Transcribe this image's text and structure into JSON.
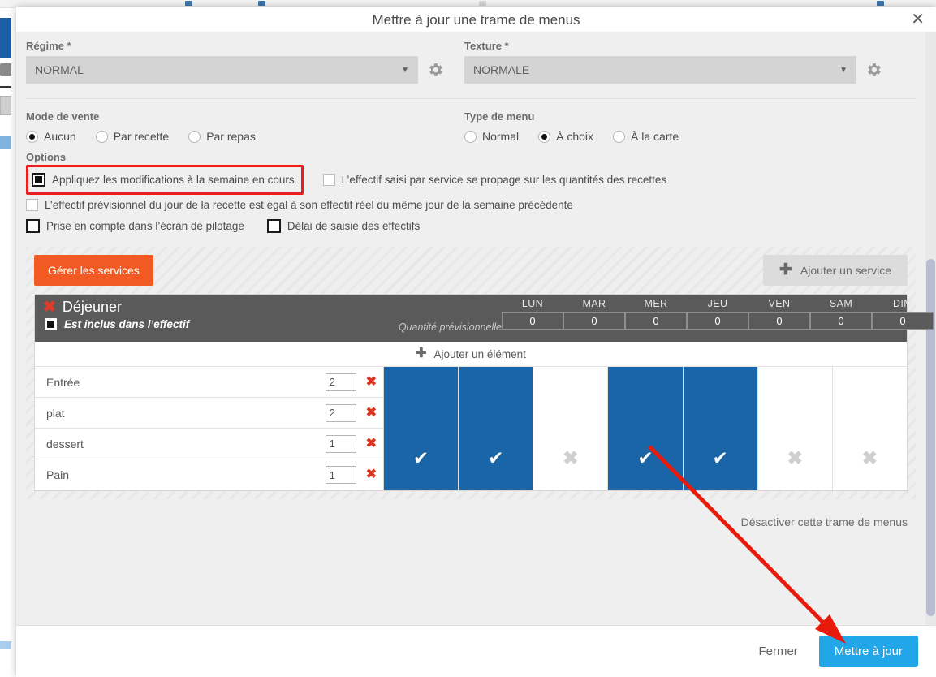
{
  "modal": {
    "title": "Mettre à jour une trame de menus",
    "close_icon": "close-icon"
  },
  "fields": {
    "regime": {
      "label": "Régime *",
      "value": "NORMAL",
      "gear_icon": "gear-icon"
    },
    "texture": {
      "label": "Texture *",
      "value": "NORMALE",
      "gear_icon": "gear-icon"
    }
  },
  "sale_mode": {
    "title": "Mode de vente",
    "options": [
      {
        "label": "Aucun",
        "selected": true
      },
      {
        "label": "Par recette",
        "selected": false
      },
      {
        "label": "Par repas",
        "selected": false
      }
    ]
  },
  "menu_type": {
    "title": "Type de menu",
    "options": [
      {
        "label": "Normal",
        "selected": false
      },
      {
        "label": "À choix",
        "selected": true
      },
      {
        "label": "À la carte",
        "selected": false
      }
    ]
  },
  "options": {
    "title": "Options",
    "items": [
      {
        "label": "Appliquez les modifications à la semaine en cours",
        "checked": true,
        "highlighted": true
      },
      {
        "label": "L’effectif saisi par service se propage sur les quantités des recettes",
        "checked": false,
        "highlighted": false
      },
      {
        "label": "L’effectif prévisionnel du jour de la recette est égal à son effectif réel du même jour de la semaine précédente",
        "checked": false,
        "highlighted": false
      },
      {
        "label": "Prise en compte dans l’écran de pilotage",
        "checked": false,
        "highlighted": false
      },
      {
        "label": "Délai de saisie des effectifs",
        "checked": false,
        "highlighted": false
      }
    ]
  },
  "services_toolbar": {
    "manage_label": "Gérer les services",
    "add_service_label": "Ajouter un service",
    "add_icon": "plus-icon"
  },
  "service": {
    "name": "Déjeuner",
    "delete_icon": "delete-x-icon",
    "included_label": "Est inclus dans l’effectif",
    "included_checked": true,
    "qty_label": "Quantité prévisionnelle",
    "days": [
      "LUN",
      "MAR",
      "MER",
      "JEU",
      "VEN",
      "SAM",
      "DIM"
    ],
    "day_quantities": [
      "0",
      "0",
      "0",
      "0",
      "0",
      "0",
      "0"
    ],
    "add_element_label": "Ajouter un élément",
    "add_element_icon": "plus-icon",
    "elements": [
      {
        "name": "Entrée",
        "qty": "2",
        "days": [
          true,
          true,
          false,
          true,
          true,
          false,
          false
        ]
      },
      {
        "name": "plat",
        "qty": "2",
        "days": [
          true,
          true,
          false,
          true,
          true,
          false,
          false
        ]
      },
      {
        "name": "dessert",
        "qty": "1",
        "days": [
          true,
          true,
          false,
          true,
          true,
          false,
          false
        ]
      },
      {
        "name": "Pain",
        "qty": "1",
        "days": [
          true,
          true,
          false,
          true,
          true,
          false,
          false
        ]
      }
    ],
    "mark_on": "✔",
    "mark_off": "✖"
  },
  "deactivate_link": "Désactiver cette trame de menus",
  "footer": {
    "close_label": "Fermer",
    "update_label": "Mettre à jour"
  },
  "colors": {
    "accent_blue": "#1a64a8",
    "primary_button": "#21a6e8",
    "orange": "#f15a22",
    "header_gray": "#5a5a5a",
    "highlight_red": "#ee1c1c",
    "annotation_red": "#e81a0c"
  }
}
